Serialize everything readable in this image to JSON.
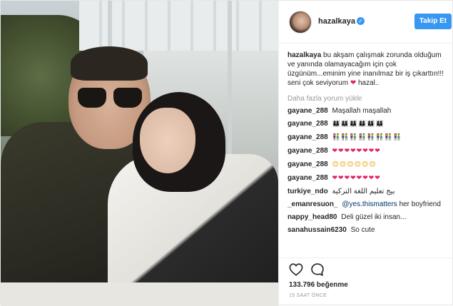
{
  "post": {
    "username": "hazalkaya",
    "follow_label": "Takip Et",
    "caption_user": "hazalkaya",
    "caption_text": "bu akşam çalışmak zorunda olduğum ve yanında olamayacağım için çok üzgünüm...eminim yine inanılmaz bir iş çıkarttın!!! seni çok seviyorum",
    "caption_tail": "hazal..",
    "load_more": "Daha fazla yorum yükle",
    "likes": "133.796 beğenme",
    "time": "15 SAAT ÖNCE"
  },
  "comments": [
    {
      "user": "gayane_288",
      "text": "Maşallah maşallah"
    },
    {
      "user": "gayane_288",
      "text": "👩‍👩‍👦👩‍👩‍👦👩‍👩‍👦👩‍👩‍👦👩‍👩‍👦👩‍👩‍👦"
    },
    {
      "user": "gayane_288",
      "text": "👫👫👫👫👫👫👫👫"
    },
    {
      "user": "gayane_288",
      "text": "❤❤❤❤❤❤❤❤"
    },
    {
      "user": "gayane_288",
      "text": "😊😊😊😊😊😊"
    },
    {
      "user": "gayane_288",
      "text": "❤❤❤❤❤❤❤❤"
    },
    {
      "user": "turkiye_ndo",
      "text": "بيج تعليم اللغة التركية"
    },
    {
      "user": "_emanresuon_",
      "mention": "@yes.thismatters",
      "text": "her boyfriend"
    },
    {
      "user": "nappy_head80",
      "text": "Deli güzel iki insan..."
    },
    {
      "user": "sanahussain6230",
      "text": "So cute"
    }
  ],
  "icons": {
    "like": "heart-outline-icon",
    "comment": "speech-bubble-icon",
    "verified": "verified-badge-icon"
  },
  "colors": {
    "accent": "#3897f0",
    "heart": "#e0245e"
  }
}
